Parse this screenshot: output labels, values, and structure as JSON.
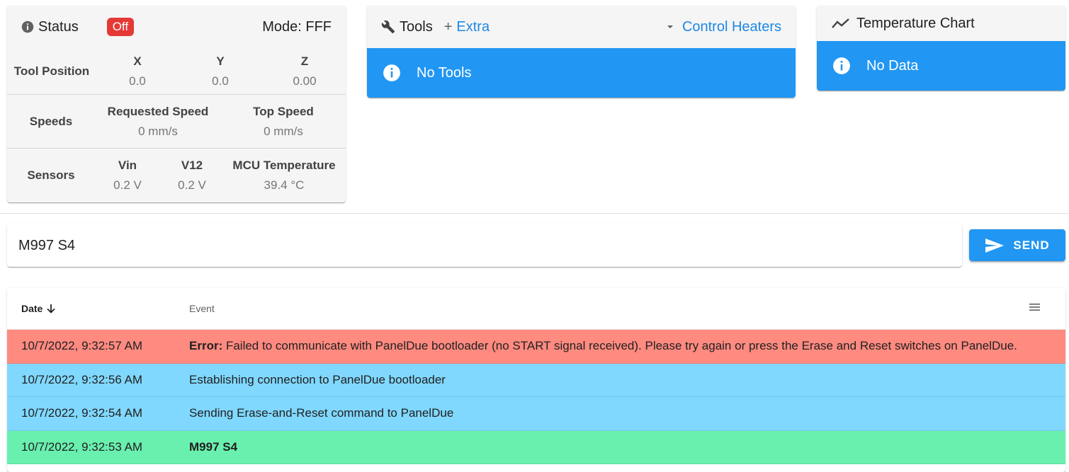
{
  "status": {
    "title": "Status",
    "badge": "Off",
    "mode": "Mode: FFF",
    "tool_position": {
      "label": "Tool Position",
      "axes": [
        {
          "name": "X",
          "value": "0.0"
        },
        {
          "name": "Y",
          "value": "0.0"
        },
        {
          "name": "Z",
          "value": "0.00"
        }
      ]
    },
    "speeds": {
      "label": "Speeds",
      "items": [
        {
          "name": "Requested Speed",
          "value": "0 mm/s"
        },
        {
          "name": "Top Speed",
          "value": "0 mm/s"
        }
      ]
    },
    "sensors": {
      "label": "Sensors",
      "items": [
        {
          "name": "Vin",
          "value": "0.2 V"
        },
        {
          "name": "V12",
          "value": "0.2 V"
        },
        {
          "name": "MCU Temperature",
          "value": "39.4 °C"
        }
      ]
    },
    "colors": {
      "badge": "#e53935"
    }
  },
  "tools": {
    "title": "Tools",
    "extra": "Extra",
    "control_heaters": "Control Heaters",
    "alert": "No Tools"
  },
  "temperature_chart": {
    "title": "Temperature Chart",
    "alert": "No Data"
  },
  "command": {
    "value": "M997 S4",
    "send_label": "SEND"
  },
  "events": {
    "headers": {
      "date": "Date",
      "event": "Event"
    },
    "rows": [
      {
        "date": "10/7/2022, 9:32:57 AM",
        "prefix": "Error:",
        "text": " Failed to communicate with PanelDue bootloader (no START signal received). Please try again or press the Erase and Reset switches on PanelDue.",
        "color": "#ff8a80"
      },
      {
        "date": "10/7/2022, 9:32:56 AM",
        "prefix": "",
        "text": "Establishing connection to PanelDue bootloader",
        "color": "#80d8ff"
      },
      {
        "date": "10/7/2022, 9:32:54 AM",
        "prefix": "",
        "text": "Sending Erase-and-Reset command to PanelDue",
        "color": "#80d8ff"
      },
      {
        "date": "10/7/2022, 9:32:53 AM",
        "prefix": "M997 S4",
        "text": "",
        "color": "#69f0ae"
      }
    ]
  },
  "icons": {
    "status": "info-circle-icon",
    "tools": "wrench-icon",
    "extra": "plus-icon",
    "heaters": "caret-down-icon",
    "chart": "chart-line-icon",
    "alert": "info-icon",
    "send": "send-icon",
    "sort": "arrow-down-icon",
    "menu": "menu-icon"
  },
  "colors": {
    "accent": "#2196f3",
    "link": "#1e88e5"
  }
}
